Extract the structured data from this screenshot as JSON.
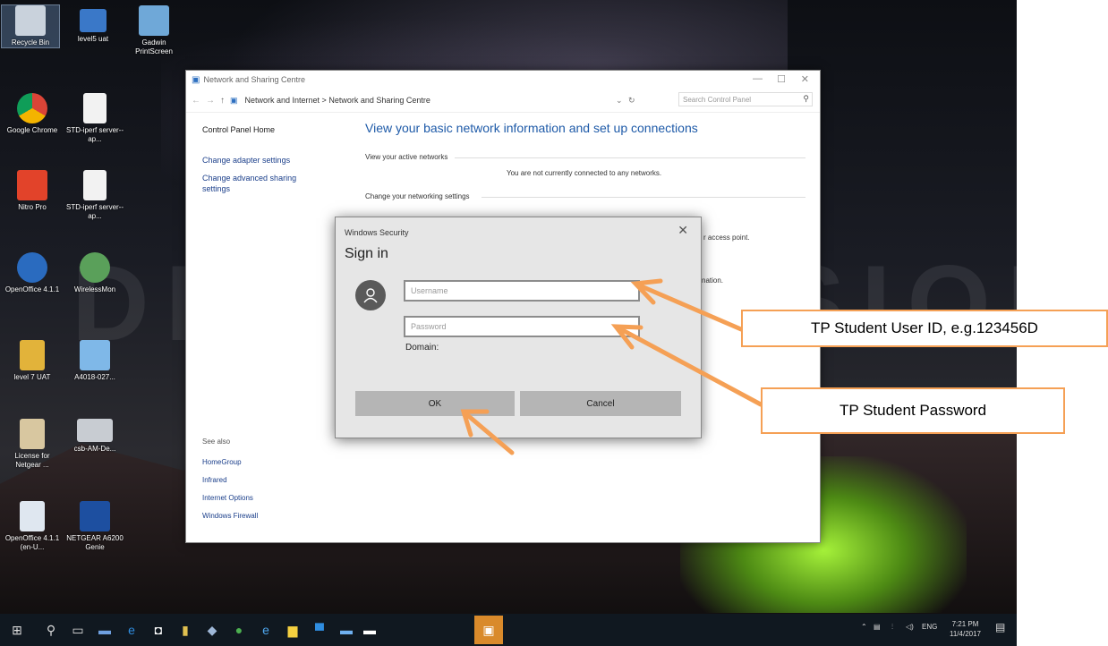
{
  "watermark": "DEMO VERSION",
  "desktop": {
    "icons": [
      {
        "label": "Recycle Bin"
      },
      {
        "label": "level5 uat"
      },
      {
        "label": "Gadwin PrintScreen"
      },
      {
        "label": "Google Chrome"
      },
      {
        "label": "STD-iperf server--ap..."
      },
      {
        "label": "Nitro Pro"
      },
      {
        "label": "STD-iperf server--ap..."
      },
      {
        "label": "OpenOffice 4.1.1"
      },
      {
        "label": "WirelessMon"
      },
      {
        "label": "level 7 UAT"
      },
      {
        "label": "A4018-027..."
      },
      {
        "label": "License for Netgear ..."
      },
      {
        "label": "csb-AM-De..."
      },
      {
        "label": "OpenOffice 4.1.1 (en-U..."
      },
      {
        "label": "NETGEAR A6200 Genie"
      }
    ]
  },
  "network_window": {
    "title": "Network and Sharing Centre",
    "controls": {
      "minimize": "—",
      "maximize": "☐",
      "close": "✕"
    },
    "breadcrumb": "Network and Internet  >  Network and Sharing Centre",
    "search_placeholder": "Search Control Panel",
    "heading": "View your basic network information and set up connections",
    "left_links": [
      "Control Panel Home",
      "Change adapter settings",
      "Change advanced sharing settings"
    ],
    "active_networks_label": "View your active networks",
    "active_networks_status": "You are not currently connected to any networks.",
    "change_settings_label": "Change your networking settings",
    "hint_access_point": "r access point.",
    "hint_information": "nation.",
    "see_also": "See also",
    "see_also_links": [
      "HomeGroup",
      "Infrared",
      "Internet Options",
      "Windows Firewall"
    ]
  },
  "dialog": {
    "title": "Windows Security",
    "close": "✕",
    "heading": "Sign in",
    "username_placeholder": "Username",
    "password_placeholder": "Password",
    "domain_label": "Domain:",
    "ok_label": "OK",
    "cancel_label": "Cancel"
  },
  "callouts": {
    "user_id": "TP Student User ID, e.g.123456D",
    "password": "TP Student Password"
  },
  "colors": {
    "accent_arrow": "#f5a055",
    "heading_blue": "#1e5aa8"
  },
  "taskbar": {
    "tray": {
      "language": "ENG",
      "time": "7:21 PM",
      "date": "11/4/2017"
    }
  }
}
